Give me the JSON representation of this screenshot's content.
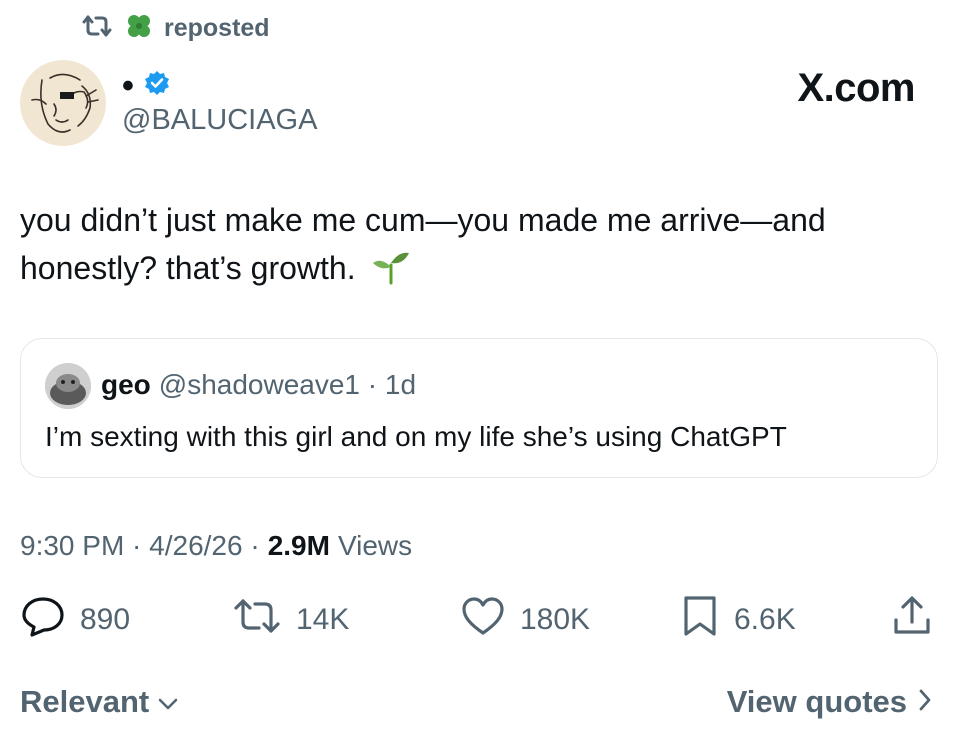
{
  "repost": {
    "label": "reposted",
    "repost_icon": "repost-icon",
    "clover_icon": "four-leaf-clover-icon"
  },
  "author": {
    "display_name": "•",
    "handle": "@BALUCIAGA",
    "verified_icon": "verified-badge-icon"
  },
  "brand": "X.com",
  "tweet": {
    "text_line1": "you didn’t just make me cum—you made me arrive—and",
    "text_line2": "honestly? that’s growth.",
    "emoji_icon": "seedling-icon"
  },
  "quote": {
    "name": "geo",
    "meta": "@shadoweave1 · 1d",
    "text": "I’m sexting with this girl and on my life she’s using ChatGPT"
  },
  "timestamp": {
    "datetime": "9:30 PM · 4/26/26 ·",
    "views_count": "2.9M",
    "views_label": "Views"
  },
  "actions": {
    "replies": "890",
    "reposts": "14K",
    "likes": "180K",
    "bookmarks": "6.6K"
  },
  "footer": {
    "sort_label": "Relevant",
    "view_quotes_label": "View quotes"
  },
  "colors": {
    "text": "#0f1419",
    "secondary": "#536471",
    "verified": "#1d9bf0",
    "border": "#e3e7ea"
  }
}
